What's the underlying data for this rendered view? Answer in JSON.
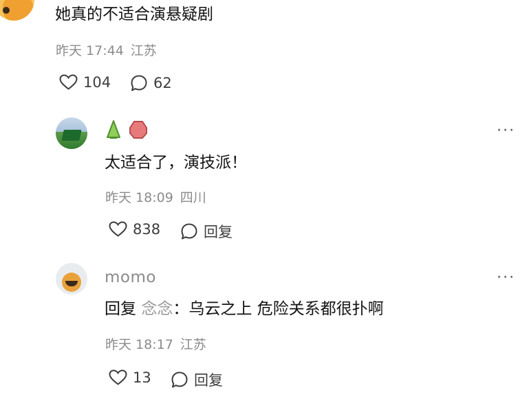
{
  "top_comment": {
    "text": "她真的不适合演悬疑剧",
    "time": "昨天 17:44",
    "location": "江苏",
    "likes": "104",
    "comments": "62"
  },
  "replies": [
    {
      "username": "",
      "text": "太适合了，演技派！",
      "time": "昨天 18:09",
      "location": "四川",
      "likes": "838",
      "reply_label": "回复",
      "more": "···"
    },
    {
      "username": "momo",
      "reply_prefix": "回复",
      "mention": "念念",
      "separator": "：",
      "text": "乌云之上 危险关系都很扑啊",
      "time": "昨天 18:17",
      "location": "江苏",
      "likes": "13",
      "reply_label": "回复",
      "more": "···"
    }
  ],
  "colors": {
    "text": "#141414",
    "meta": "#8b8b8b",
    "badge_green": "#7bbf4a",
    "badge_red": "#e06a6a"
  },
  "icons": [
    "heart-icon",
    "comment-bubble-icon",
    "more-icon"
  ]
}
